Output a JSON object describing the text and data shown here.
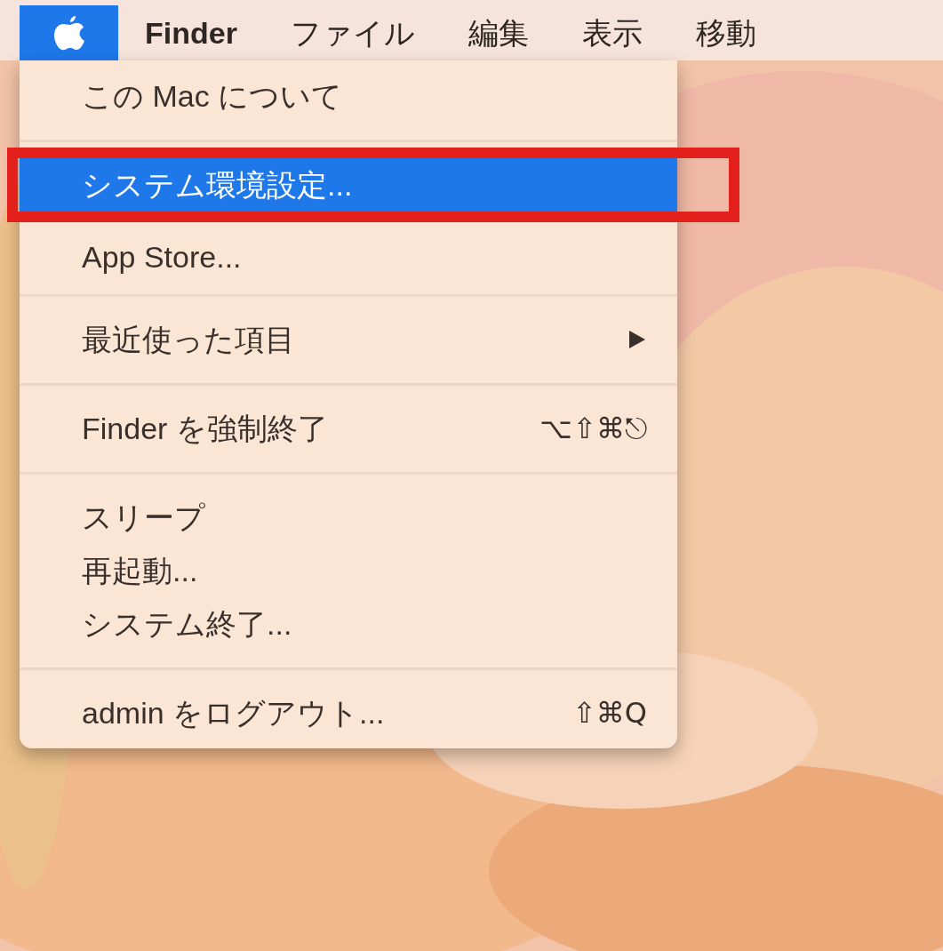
{
  "menu_bar": {
    "items": [
      {
        "kind": "apple",
        "selected": true
      },
      {
        "kind": "app",
        "label": "Finder",
        "selected": false
      },
      {
        "kind": "menu",
        "label": "ファイル",
        "selected": false
      },
      {
        "kind": "menu",
        "label": "編集",
        "selected": false
      },
      {
        "kind": "menu",
        "label": "表示",
        "selected": false
      },
      {
        "kind": "menu",
        "label": "移動",
        "selected": false
      }
    ]
  },
  "menu": {
    "items": [
      {
        "kind": "item",
        "label": "この Mac について",
        "selected": false
      },
      {
        "kind": "separator"
      },
      {
        "kind": "item",
        "label": "システム環境設定...",
        "selected": true,
        "annotated": true
      },
      {
        "kind": "item",
        "label": "App Store...",
        "selected": false
      },
      {
        "kind": "separator"
      },
      {
        "kind": "item",
        "label": "最近使った項目",
        "selected": false,
        "submenu": true
      },
      {
        "kind": "separator"
      },
      {
        "kind": "item",
        "label": "Finder を強制終了",
        "selected": false,
        "shortcut": "⌥⇧⌘⎋"
      },
      {
        "kind": "separator"
      },
      {
        "kind": "item",
        "label": "スリープ",
        "selected": false
      },
      {
        "kind": "item",
        "label": "再起動...",
        "selected": false
      },
      {
        "kind": "item",
        "label": "システム終了...",
        "selected": false
      },
      {
        "kind": "separator"
      },
      {
        "kind": "item",
        "label": "admin をログアウト...",
        "selected": false,
        "shortcut": "⇧⌘Q"
      }
    ]
  }
}
